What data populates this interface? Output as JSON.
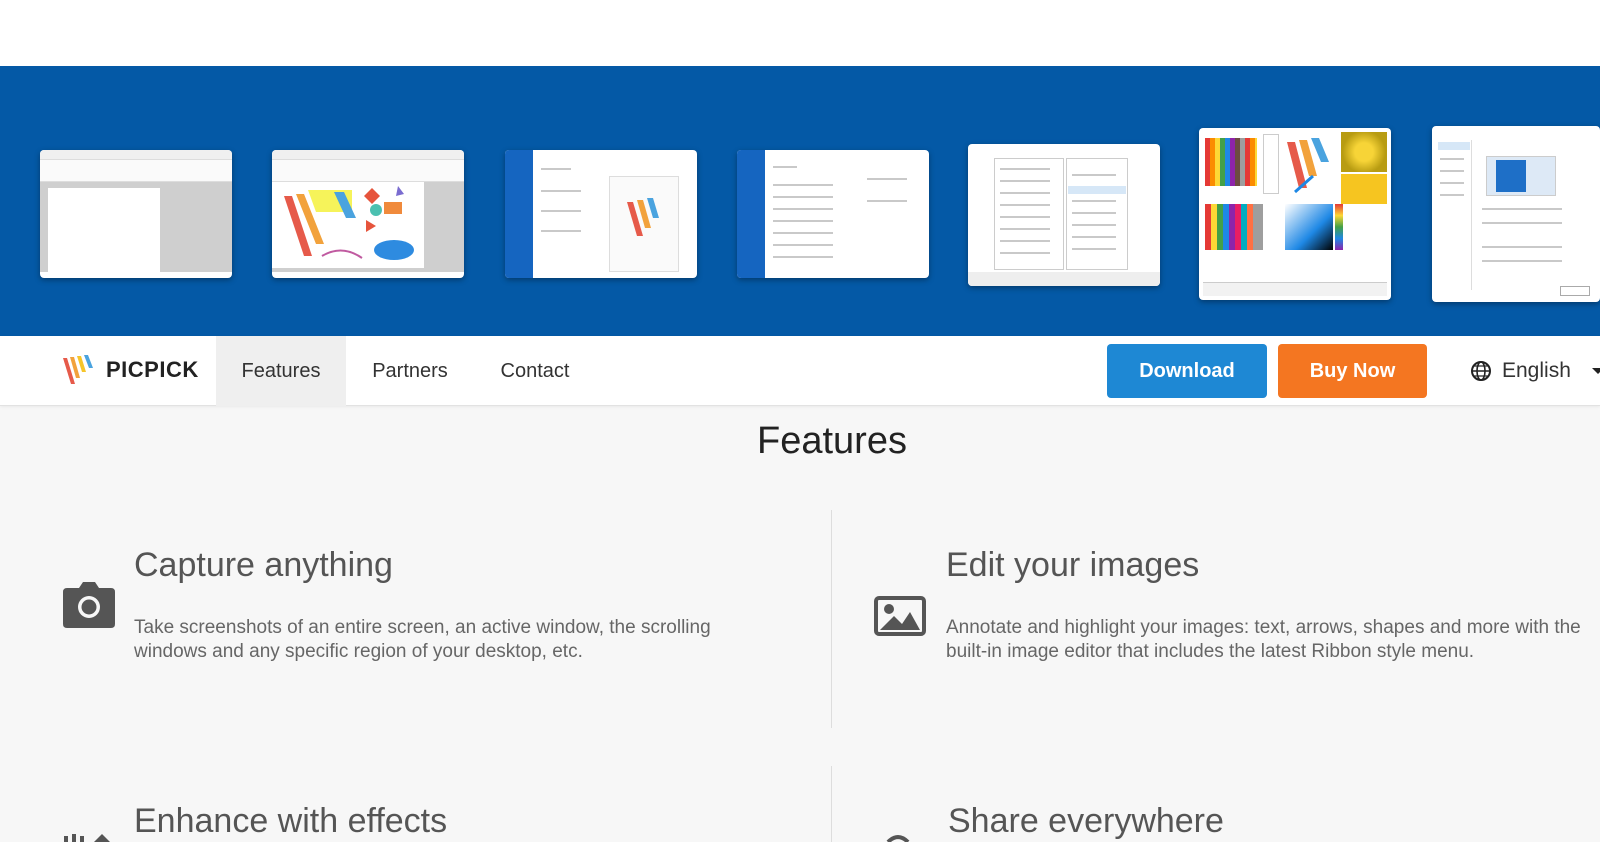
{
  "brand": {
    "name": "PICPICK"
  },
  "nav": {
    "items": [
      {
        "label": "Features",
        "active": true
      },
      {
        "label": "Partners",
        "active": false
      },
      {
        "label": "Contact",
        "active": false
      }
    ],
    "download_label": "Download",
    "buy_label": "Buy Now",
    "language": "English"
  },
  "colors": {
    "banner": "#0459a6",
    "download": "#1e88d4",
    "buy": "#f47621"
  },
  "section": {
    "title": "Features"
  },
  "features": [
    {
      "title": "Capture anything",
      "description": "Take screenshots of an entire screen, an active window, the scrolling windows and any specific region of your desktop, etc.",
      "icon": "camera-icon"
    },
    {
      "title": "Edit your images",
      "description": "Annotate and highlight your images: text, arrows, shapes and more with the built-in image editor that includes the latest Ribbon style menu.",
      "icon": "image-icon"
    },
    {
      "title": "Enhance with effects",
      "icon": "effects-icon"
    },
    {
      "title": "Share everywhere",
      "icon": "share-icon"
    }
  ]
}
